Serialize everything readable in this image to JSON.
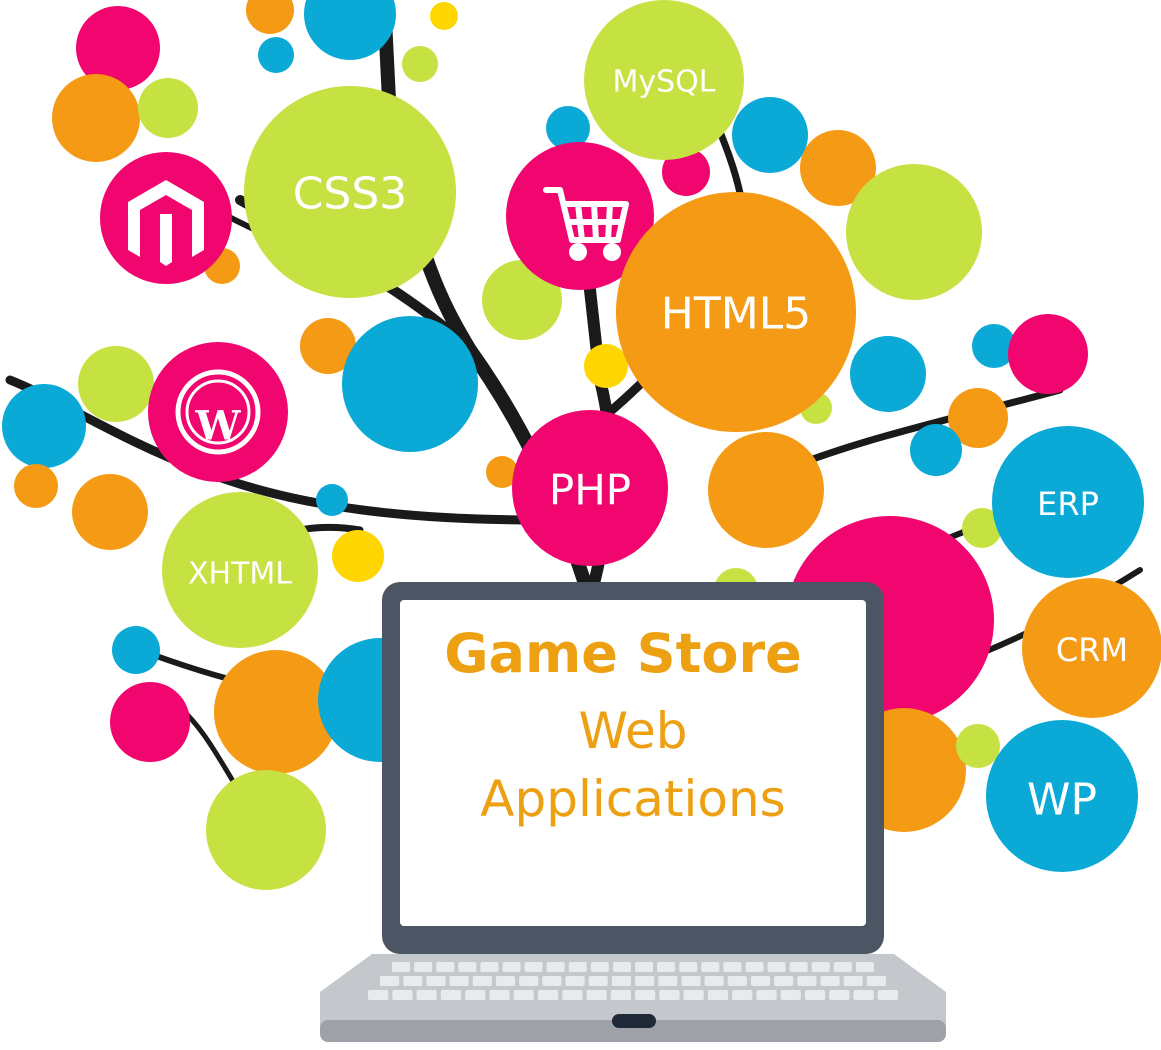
{
  "colors": {
    "pink": "#f0066e",
    "green": "#c5e142",
    "blue": "#0aa9d6",
    "orange": "#f59a14",
    "yellow": "#ffd600",
    "branch": "#1a1a1a",
    "laptop_frame": "#4b5563",
    "laptop_base": "#b9bcc0",
    "screen_text": "#eea013"
  },
  "bubbles": {
    "mysql": "MySQL",
    "css3": "CSS3",
    "html5": "HTML5",
    "php": "PHP",
    "xhtml": "XHTML",
    "erp": "ERP",
    "crm": "CRM",
    "wp": "WP"
  },
  "icons": {
    "magento": "magento-icon",
    "cart": "shopping-cart-icon",
    "wordpress": "wordpress-icon"
  },
  "screen": {
    "title": "Game Store",
    "line1": "Web",
    "line2": "Applications"
  }
}
